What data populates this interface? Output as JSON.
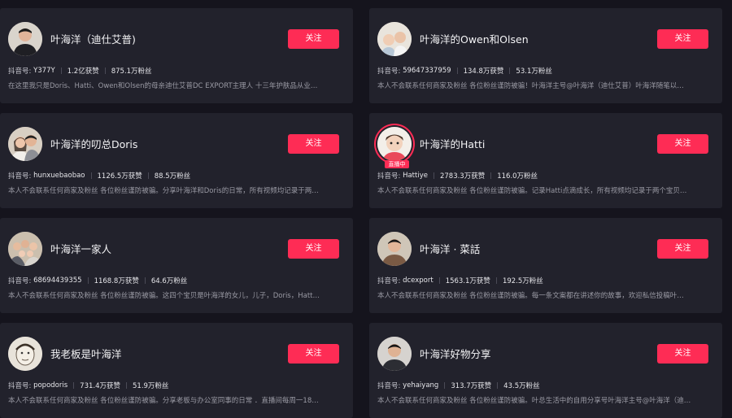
{
  "follow_label": "关注",
  "live_badge": "直播中",
  "cards": [
    {
      "name": "叶海洋（迪仕艾普)",
      "id_label": "抖音号:",
      "id": "Y377Y",
      "likes": "1.2亿获赞",
      "fans": "875.1万粉丝",
      "desc": "在这里我只是Doris、Hatti、Owen和Olsen的母亲迪仕艾普DC EXPORT主理人 十三年护肤品从业…"
    },
    {
      "name": "叶海洋的Owen和Olsen",
      "id_label": "抖音号:",
      "id": "59647337959",
      "likes": "134.8万获赞",
      "fans": "53.1万粉丝",
      "desc": "本人不会联系任何商家及粉丝 各位粉丝谨防被骗！叶海洋主号@叶海洋（迪仕艾普）叶海洋随笔以…"
    },
    {
      "name": "叶海洋的叨总Doris",
      "id_label": "抖音号:",
      "id": "hunxuebaobao",
      "likes": "1126.5万获赞",
      "fans": "88.5万粉丝",
      "desc": "本人不会联系任何商家及粉丝 各位粉丝谨防被骗。分享叶海洋和Doris的日常，所有视频均记录于两…"
    },
    {
      "name": "叶海洋的Hatti",
      "id_label": "抖音号:",
      "id": "Hattiye",
      "likes": "2783.3万获赞",
      "fans": "116.0万粉丝",
      "desc": "本人不会联系任何商家及粉丝 各位粉丝谨防被骗。记录Hatti点滴成长，所有视频均记录于两个宝贝…",
      "live": true
    },
    {
      "name": "叶海洋一家人",
      "id_label": "抖音号:",
      "id": "68694439355",
      "likes": "1168.8万获赞",
      "fans": "64.6万粉丝",
      "desc": "本人不会联系任何商家及粉丝 各位粉丝谨防被骗。这四个宝贝是叶海洋的女儿，儿子，Doris，Hatt…"
    },
    {
      "name": "叶海洋 · 菜話",
      "id_label": "抖音号:",
      "id": "dcexport",
      "likes": "1563.1万获赞",
      "fans": "192.5万粉丝",
      "desc": "本人不会联系任何商家及粉丝 各位粉丝谨防被骗。每一条文案都在讲述你的故事，欢迎私信投稿叶…"
    },
    {
      "name": "我老板是叶海洋",
      "id_label": "抖音号:",
      "id": "popodoris",
      "likes": "731.4万获赞",
      "fans": "51.9万粉丝",
      "desc": "本人不会联系任何商家及粉丝 各位粉丝谨防被骗。分享老板与办公室同事的日常 ．直播间每周一18…"
    },
    {
      "name": "叶海洋好物分享",
      "id_label": "抖音号:",
      "id": "yehaiyang",
      "likes": "313.7万获赞",
      "fans": "43.5万粉丝",
      "desc": "本人不会联系任何商家及粉丝 各位粉丝谨防被骗。叶总生活中的自用分享号叶海洋主号@叶海洋（迪…"
    }
  ]
}
